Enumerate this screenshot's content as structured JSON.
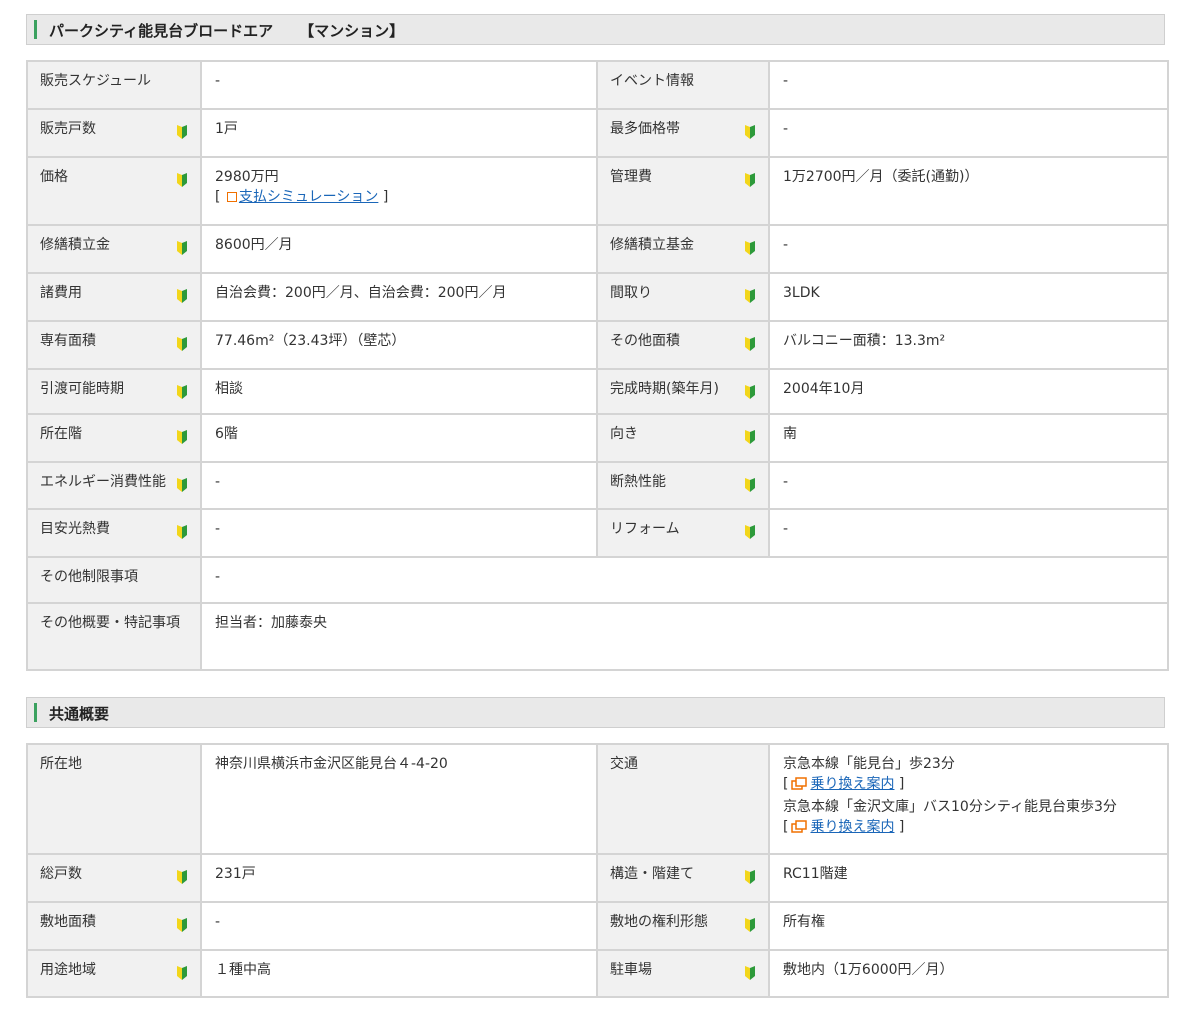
{
  "property": {
    "name": "パークシティ能見台ブロードエア",
    "kind": "【マンション】"
  },
  "sale_rows": [
    [
      {
        "label": "販売スケジュール",
        "badge": false,
        "lines": [
          "-"
        ]
      },
      {
        "label": "イベント情報",
        "badge": false,
        "lines": [
          "-"
        ]
      }
    ],
    [
      {
        "label": "販売戸数",
        "badge": true,
        "lines": [
          "1戸"
        ]
      },
      {
        "label": "最多価格帯",
        "badge": true,
        "lines": [
          "-"
        ]
      }
    ],
    [
      {
        "label": "価格",
        "badge": true,
        "lines": [
          "2980万円"
        ],
        "link_line": {
          "open": "[",
          "text": "支払シミュレーション",
          "close": "]",
          "icon": "calculator-icon"
        }
      },
      {
        "label": "管理費",
        "badge": true,
        "lines": [
          "1万2700円／月（委託(通勤)）"
        ]
      }
    ],
    [
      {
        "label": "修繕積立金",
        "badge": true,
        "lines": [
          "8600円／月"
        ]
      },
      {
        "label": "修繕積立基金",
        "badge": true,
        "lines": [
          "-"
        ]
      }
    ],
    [
      {
        "label": "諸費用",
        "badge": true,
        "lines": [
          "自治会費：200円／月、自治会費：200円／月"
        ]
      },
      {
        "label": "間取り",
        "badge": true,
        "lines": [
          "3LDK"
        ]
      }
    ],
    [
      {
        "label": "専有面積",
        "badge": true,
        "lines": [
          "77.46m²（23.43坪）（壁芯）"
        ]
      },
      {
        "label": "その他面積",
        "badge": true,
        "lines": [
          "バルコニー面積：13.3m²"
        ]
      }
    ],
    [
      {
        "label": "引渡可能時期",
        "badge": true,
        "lines": [
          "相談"
        ]
      },
      {
        "label": "完成時期(築年月)",
        "badge": true,
        "lines": [
          "2004年10月"
        ]
      }
    ],
    [
      {
        "label": "所在階",
        "badge": true,
        "lines": [
          "6階"
        ]
      },
      {
        "label": "向き",
        "badge": true,
        "lines": [
          "南"
        ]
      }
    ],
    [
      {
        "label": "エネルギー消費性能",
        "badge": true,
        "lines": [
          "-"
        ]
      },
      {
        "label": "断熱性能",
        "badge": true,
        "lines": [
          "-"
        ]
      }
    ],
    [
      {
        "label": "目安光熱費",
        "badge": true,
        "lines": [
          "-"
        ]
      },
      {
        "label": "リフォーム",
        "badge": true,
        "lines": [
          "-"
        ]
      }
    ]
  ],
  "sale_full_rows": [
    {
      "label": "その他制限事項",
      "lines": [
        "-"
      ]
    },
    {
      "label": "その他概要・特記事項",
      "lines": [
        "担当者：加藤泰央"
      ]
    }
  ],
  "common": {
    "title": "共通概要",
    "location_label": "所在地",
    "location_value": "神奈川県横浜市金沢区能見台４-4-20",
    "transport_label": "交通",
    "transport_routes": [
      {
        "route": "京急本線「能見台」歩23分",
        "open": "[",
        "link": "乗り換え案内",
        "close": "]"
      },
      {
        "route": "京急本線「金沢文庫」バス10分シティ能見台東歩3分",
        "open": "[",
        "link": "乗り換え案内",
        "close": "]"
      }
    ],
    "rows": [
      [
        {
          "label": "総戸数",
          "badge": true,
          "lines": [
            "231戸"
          ]
        },
        {
          "label": "構造・階建て",
          "badge": true,
          "lines": [
            "RC11階建"
          ]
        }
      ],
      [
        {
          "label": "敷地面積",
          "badge": true,
          "lines": [
            "-"
          ]
        },
        {
          "label": "敷地の権利形態",
          "badge": true,
          "lines": [
            "所有権"
          ]
        }
      ],
      [
        {
          "label": "用途地域",
          "badge": true,
          "lines": [
            "１種中高"
          ]
        },
        {
          "label": "駐車場",
          "badge": true,
          "lines": [
            "敷地内（1万6000円／月）"
          ]
        }
      ]
    ]
  },
  "colors": {
    "accent_bar": "#3ba15f",
    "link": "#1a66b8",
    "header_bg": "#e9e9e9",
    "label_bg": "#f1f1f1",
    "badge_green": "#2d9a3a",
    "badge_yellow": "#f2d61b"
  },
  "icons": {
    "beginner_badge": "beginner-mark-icon",
    "simulation": "calculator-icon",
    "transfer": "train-transfer-icon"
  }
}
